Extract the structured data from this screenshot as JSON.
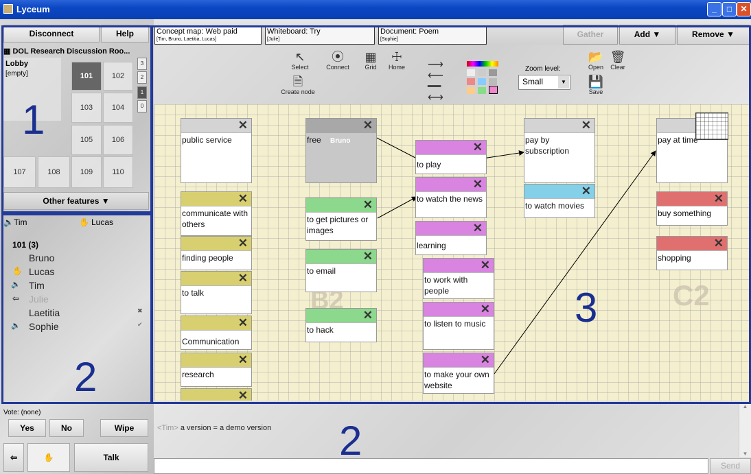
{
  "window": {
    "title": "Lyceum"
  },
  "left": {
    "disconnect": "Disconnect",
    "help": "Help",
    "room_title": "DOL Research Discussion Roo...",
    "lobby": "Lobby",
    "lobby_status": "[empty]",
    "rooms": [
      "101",
      "102",
      "103",
      "104",
      "105",
      "106",
      "107",
      "108",
      "109",
      "110"
    ],
    "levels": [
      "3",
      "2",
      "1",
      "0"
    ],
    "other_features": "Other features ▼",
    "annotation_1": "1",
    "speakers": {
      "speaker": "Tim",
      "hand": "Lucas"
    },
    "roster_header": "101  (3)",
    "roster": [
      "Bruno",
      "Lucas",
      "Tim",
      "Julie",
      "Laetitia",
      "Sophie"
    ],
    "annotation_2": "2",
    "vote": "Vote: (none)",
    "yes": "Yes",
    "no": "No",
    "wipe": "Wipe",
    "talk": "Talk"
  },
  "tabs": {
    "concept_map": {
      "title": "Concept map: Web paid",
      "members": "[Tim, Bruno, Laetitia, Lucas]"
    },
    "whiteboard": {
      "title": "Whiteboard: Try",
      "members": "[Julie]"
    },
    "document": {
      "title": "Document: Poem",
      "members": "[Sophie]"
    }
  },
  "top_buttons": {
    "gather": "Gather",
    "add": "Add ▼",
    "remove": "Remove ▼"
  },
  "toolbar": {
    "select": "Select",
    "connect": "Connect",
    "grid": "Grid",
    "home": "Home",
    "create_node": "Create node",
    "zoom_label": "Zoom level:",
    "zoom_value": "Small",
    "open": "Open",
    "clear": "Clear",
    "save": "Save"
  },
  "nodes": {
    "public_service": "public service",
    "communicate": "communicate with others",
    "finding_people": "finding people",
    "to_talk": "to talk",
    "communication": "Communication",
    "research": "research",
    "free": "free",
    "free_user": "Bruno",
    "get_pictures": "to get pictures or images",
    "to_email": "to email",
    "to_hack": "to hack",
    "to_play": "to play",
    "watch_news": "to watch the news",
    "learning": "learning",
    "work_people": "to work with people",
    "listen_music": "to listen to music",
    "make_website": "to make your own website",
    "pay_subscription": "pay by subscription",
    "watch_movies": "to watch movies",
    "pay_at_time": "pay at time",
    "buy_something": "buy something",
    "shopping": "shopping"
  },
  "canvas_labels": {
    "b2": "B2",
    "c2": "C2",
    "annotation_3": "3"
  },
  "chat": {
    "sender": "<Tim>",
    "message": "a version = a demo version",
    "annotation_2": "2",
    "send": "Send"
  }
}
